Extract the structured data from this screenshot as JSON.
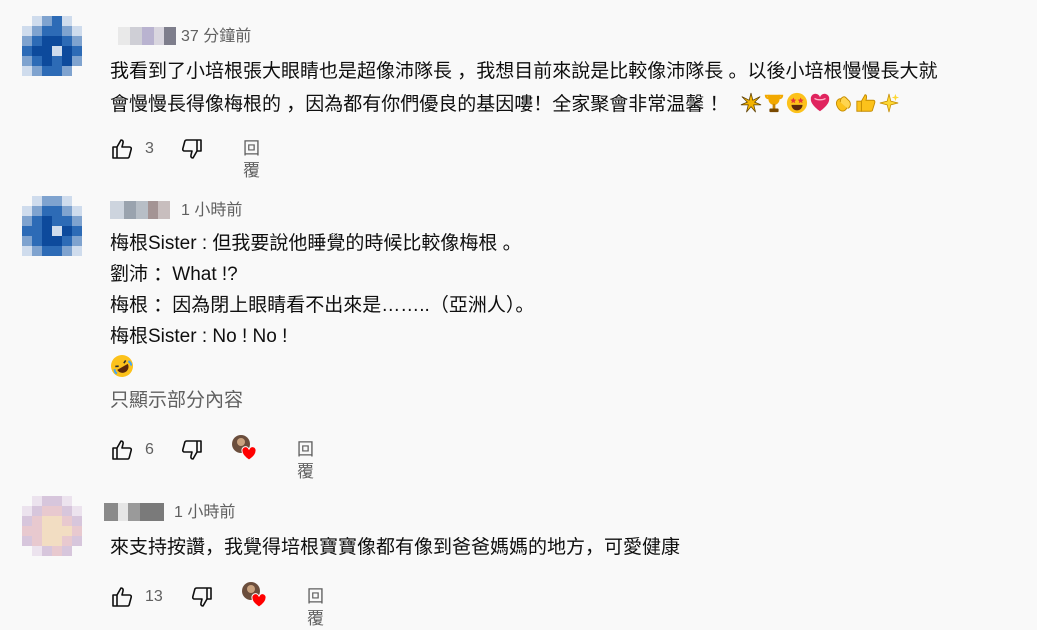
{
  "comments": [
    {
      "time": "37 分鐘前",
      "lines": [
        "我看到了小培根張大眼睛也是超像沛隊長 ，我想目前來說是比較像沛隊長 。以後小培根慢慢長大就",
        "會慢慢長得像梅根的 ，因為都有你們優良的基因嘍！全家聚會非常温馨 ！"
      ],
      "emojis": [
        "sparkle-burst",
        "trophy",
        "star-struck-face",
        "heart-with-ribbon",
        "clapping-hands",
        "thumbs-up",
        "sparkles"
      ],
      "likes": "3",
      "reply": "回覆"
    },
    {
      "time": "1 小時前",
      "lines": [
        "梅根Sister : 但我要說他睡覺的時候比較像梅根 。",
        "劉沛  ：What !?",
        "梅根  ：因為閉上眼睛看不出來是……..（亞洲人）。",
        "梅根Sister : No ! No !"
      ],
      "emojis": [
        "rolling-laughing-face"
      ],
      "read_more": "只顯示部分內容",
      "likes": "6",
      "reply": "回覆",
      "creator_heart": true
    },
    {
      "time": "1 小時前",
      "lines": [
        "來支持按讚，我覺得培根寶寶像都有像到爸爸媽媽的地方，可愛健康"
      ],
      "likes": "13",
      "reply": "回覆",
      "creator_heart": true
    }
  ],
  "colors": {
    "text": "#0f0f0f",
    "secondary": "#606060",
    "background": "#f9f9f9",
    "heart": "#ff0000"
  }
}
